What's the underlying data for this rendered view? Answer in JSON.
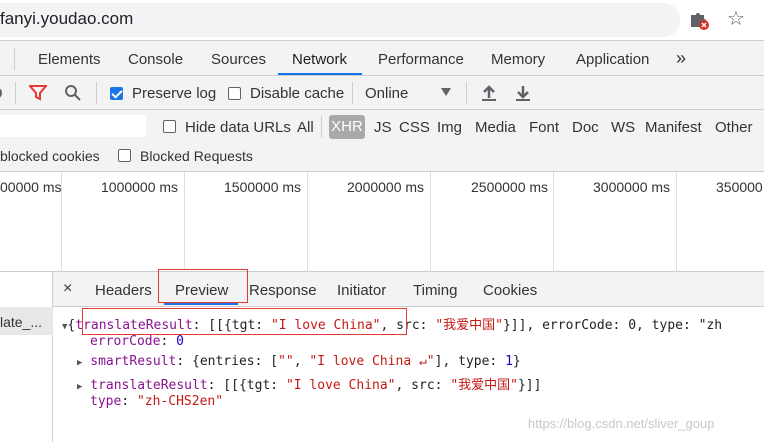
{
  "browser": {
    "url": "fanyi.youdao.com",
    "icons": [
      "extension-blocked-icon",
      "bookmark-star-icon"
    ]
  },
  "devtools": {
    "tabs": [
      "Elements",
      "Console",
      "Sources",
      "Network",
      "Performance",
      "Memory",
      "Application"
    ],
    "active_tab": "Network",
    "more_tabs": "»",
    "toolbar": {
      "preserve_log": "Preserve log",
      "preserve_log_checked": true,
      "disable_cache": "Disable cache",
      "disable_cache_checked": false,
      "throttling": "Online"
    },
    "filter": {
      "hide_data_urls": "Hide data URLs",
      "types": [
        "All",
        "XHR",
        "JS",
        "CSS",
        "Img",
        "Media",
        "Font",
        "Doc",
        "WS",
        "Manifest",
        "Other"
      ],
      "active_type": "XHR",
      "blocked_cookies": "blocked cookies",
      "blocked_requests": "Blocked Requests"
    },
    "timeline": {
      "ticks": [
        "00000 ms",
        "1000000 ms",
        "1500000 ms",
        "2000000 ms",
        "2500000 ms",
        "3000000 ms",
        "350000"
      ]
    },
    "request": {
      "name": "late_..."
    },
    "detail_tabs": {
      "close": "×",
      "items": [
        "Headers",
        "Preview",
        "Response",
        "Initiator",
        "Timing",
        "Cookies"
      ],
      "active": "Preview"
    },
    "preview": {
      "line1_brace": "{",
      "line1_key": "translateResult",
      "line1_mid": ": [[{tgt: ",
      "line1_tgt": "\"I love China\"",
      "line1_src_label": ", src: ",
      "line1_src": "\"我爱中国\"",
      "line1_tail": "}]], errorCode: 0, type: \"zh",
      "line2_key": "errorCode",
      "line2_val": "0",
      "line3_key": "smartResult",
      "line3_a": ": {entries: [",
      "line3_s1": "\"\"",
      "line3_b": ", ",
      "line3_s2": "\"I love China ↵\"",
      "line3_c": "], type: ",
      "line3_n": "1",
      "line3_d": "}",
      "line4_key": "translateResult",
      "line4_a": ": [[{tgt: ",
      "line4_s1": "\"I love China\"",
      "line4_b": ", src: ",
      "line4_s2": "\"我爱中国\"",
      "line4_c": "}]]",
      "line5_key": "type",
      "line5_val": "\"zh-CHS2en\""
    }
  },
  "watermark": "https://blog.csdn.net/sliver_goup"
}
